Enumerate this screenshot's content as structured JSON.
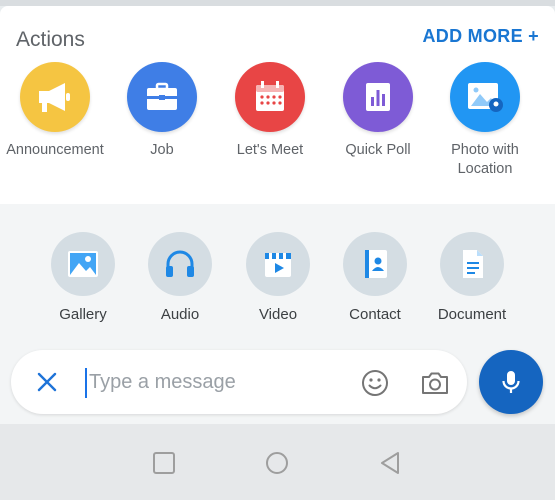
{
  "actions": {
    "title": "Actions",
    "add_more_label": "ADD MORE +",
    "items": [
      {
        "label": "Announcement",
        "icon": "megaphone-icon",
        "color": "#f5c542"
      },
      {
        "label": "Job",
        "icon": "briefcase-icon",
        "color": "#3f7ee6"
      },
      {
        "label": "Let's Meet",
        "icon": "calendar-icon",
        "color": "#e84545"
      },
      {
        "label": "Quick Poll",
        "icon": "poll-icon",
        "color": "#7e5bd6"
      },
      {
        "label": "Photo with Location",
        "icon": "photo-location-icon",
        "color": "#2196f3"
      }
    ]
  },
  "attachments": {
    "items": [
      {
        "label": "Gallery",
        "icon": "gallery-icon"
      },
      {
        "label": "Audio",
        "icon": "headphones-icon"
      },
      {
        "label": "Video",
        "icon": "video-icon"
      },
      {
        "label": "Contact",
        "icon": "contact-book-icon"
      },
      {
        "label": "Document",
        "icon": "document-icon"
      }
    ]
  },
  "composer": {
    "placeholder": "Type a message",
    "value": ""
  },
  "colors": {
    "accent": "#1976d2",
    "mic_button": "#1565c0"
  }
}
